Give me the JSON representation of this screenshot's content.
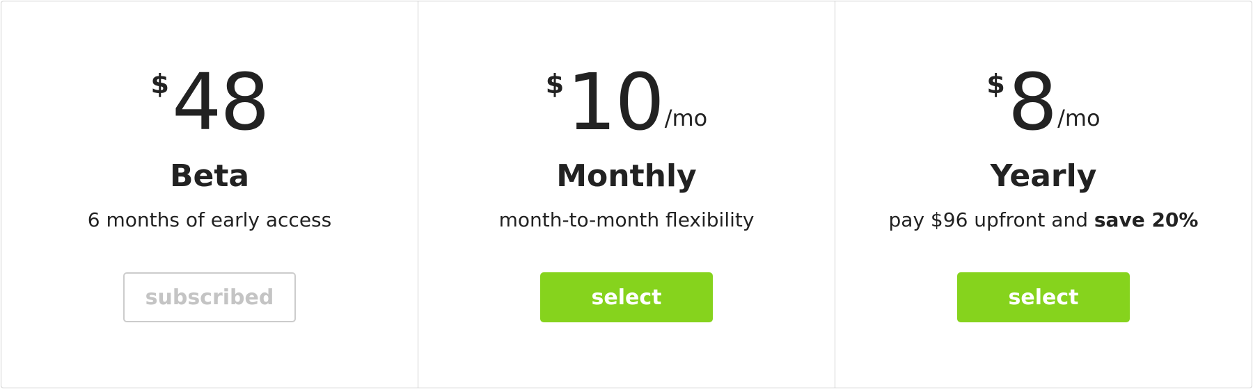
{
  "colors": {
    "text": "#222222",
    "border": "#cfcfcf",
    "select_button": "#86d31d",
    "subscribed_text": "#c4c4c4"
  },
  "plans": [
    {
      "currency": "$",
      "amount": "48",
      "unit": "",
      "name": "Beta",
      "description": "6 months of early access",
      "description_emphasis": "",
      "button_label": "subscribed",
      "button_state": "subscribed"
    },
    {
      "currency": "$",
      "amount": "10",
      "unit": "/mo",
      "name": "Monthly",
      "description": "month-to-month flexibility",
      "description_emphasis": "",
      "button_label": "select",
      "button_state": "select"
    },
    {
      "currency": "$",
      "amount": "8",
      "unit": "/mo",
      "name": "Yearly",
      "description": "pay $96 upfront and ",
      "description_emphasis": "save 20%",
      "button_label": "select",
      "button_state": "select"
    }
  ]
}
